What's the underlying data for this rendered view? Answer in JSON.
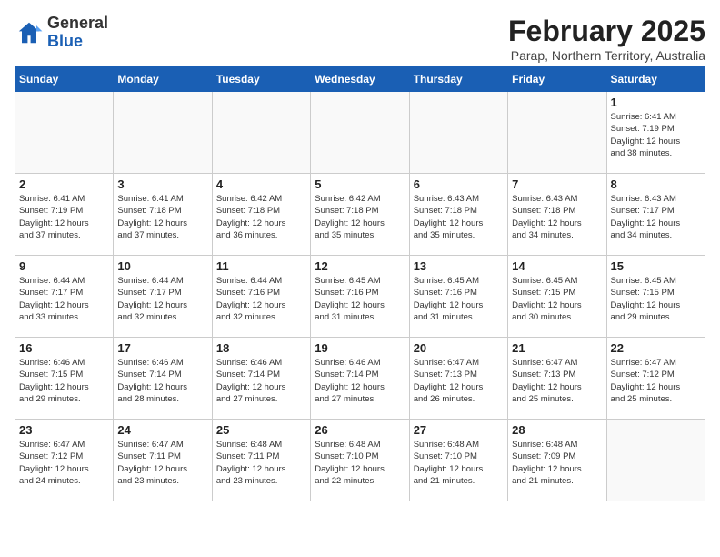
{
  "header": {
    "logo_general": "General",
    "logo_blue": "Blue",
    "title": "February 2025",
    "subtitle": "Parap, Northern Territory, Australia"
  },
  "weekdays": [
    "Sunday",
    "Monday",
    "Tuesday",
    "Wednesday",
    "Thursday",
    "Friday",
    "Saturday"
  ],
  "weeks": [
    [
      {
        "day": "",
        "info": ""
      },
      {
        "day": "",
        "info": ""
      },
      {
        "day": "",
        "info": ""
      },
      {
        "day": "",
        "info": ""
      },
      {
        "day": "",
        "info": ""
      },
      {
        "day": "",
        "info": ""
      },
      {
        "day": "1",
        "info": "Sunrise: 6:41 AM\nSunset: 7:19 PM\nDaylight: 12 hours\nand 38 minutes."
      }
    ],
    [
      {
        "day": "2",
        "info": "Sunrise: 6:41 AM\nSunset: 7:19 PM\nDaylight: 12 hours\nand 37 minutes."
      },
      {
        "day": "3",
        "info": "Sunrise: 6:41 AM\nSunset: 7:18 PM\nDaylight: 12 hours\nand 37 minutes."
      },
      {
        "day": "4",
        "info": "Sunrise: 6:42 AM\nSunset: 7:18 PM\nDaylight: 12 hours\nand 36 minutes."
      },
      {
        "day": "5",
        "info": "Sunrise: 6:42 AM\nSunset: 7:18 PM\nDaylight: 12 hours\nand 35 minutes."
      },
      {
        "day": "6",
        "info": "Sunrise: 6:43 AM\nSunset: 7:18 PM\nDaylight: 12 hours\nand 35 minutes."
      },
      {
        "day": "7",
        "info": "Sunrise: 6:43 AM\nSunset: 7:18 PM\nDaylight: 12 hours\nand 34 minutes."
      },
      {
        "day": "8",
        "info": "Sunrise: 6:43 AM\nSunset: 7:17 PM\nDaylight: 12 hours\nand 34 minutes."
      }
    ],
    [
      {
        "day": "9",
        "info": "Sunrise: 6:44 AM\nSunset: 7:17 PM\nDaylight: 12 hours\nand 33 minutes."
      },
      {
        "day": "10",
        "info": "Sunrise: 6:44 AM\nSunset: 7:17 PM\nDaylight: 12 hours\nand 32 minutes."
      },
      {
        "day": "11",
        "info": "Sunrise: 6:44 AM\nSunset: 7:16 PM\nDaylight: 12 hours\nand 32 minutes."
      },
      {
        "day": "12",
        "info": "Sunrise: 6:45 AM\nSunset: 7:16 PM\nDaylight: 12 hours\nand 31 minutes."
      },
      {
        "day": "13",
        "info": "Sunrise: 6:45 AM\nSunset: 7:16 PM\nDaylight: 12 hours\nand 31 minutes."
      },
      {
        "day": "14",
        "info": "Sunrise: 6:45 AM\nSunset: 7:15 PM\nDaylight: 12 hours\nand 30 minutes."
      },
      {
        "day": "15",
        "info": "Sunrise: 6:45 AM\nSunset: 7:15 PM\nDaylight: 12 hours\nand 29 minutes."
      }
    ],
    [
      {
        "day": "16",
        "info": "Sunrise: 6:46 AM\nSunset: 7:15 PM\nDaylight: 12 hours\nand 29 minutes."
      },
      {
        "day": "17",
        "info": "Sunrise: 6:46 AM\nSunset: 7:14 PM\nDaylight: 12 hours\nand 28 minutes."
      },
      {
        "day": "18",
        "info": "Sunrise: 6:46 AM\nSunset: 7:14 PM\nDaylight: 12 hours\nand 27 minutes."
      },
      {
        "day": "19",
        "info": "Sunrise: 6:46 AM\nSunset: 7:14 PM\nDaylight: 12 hours\nand 27 minutes."
      },
      {
        "day": "20",
        "info": "Sunrise: 6:47 AM\nSunset: 7:13 PM\nDaylight: 12 hours\nand 26 minutes."
      },
      {
        "day": "21",
        "info": "Sunrise: 6:47 AM\nSunset: 7:13 PM\nDaylight: 12 hours\nand 25 minutes."
      },
      {
        "day": "22",
        "info": "Sunrise: 6:47 AM\nSunset: 7:12 PM\nDaylight: 12 hours\nand 25 minutes."
      }
    ],
    [
      {
        "day": "23",
        "info": "Sunrise: 6:47 AM\nSunset: 7:12 PM\nDaylight: 12 hours\nand 24 minutes."
      },
      {
        "day": "24",
        "info": "Sunrise: 6:47 AM\nSunset: 7:11 PM\nDaylight: 12 hours\nand 23 minutes."
      },
      {
        "day": "25",
        "info": "Sunrise: 6:48 AM\nSunset: 7:11 PM\nDaylight: 12 hours\nand 23 minutes."
      },
      {
        "day": "26",
        "info": "Sunrise: 6:48 AM\nSunset: 7:10 PM\nDaylight: 12 hours\nand 22 minutes."
      },
      {
        "day": "27",
        "info": "Sunrise: 6:48 AM\nSunset: 7:10 PM\nDaylight: 12 hours\nand 21 minutes."
      },
      {
        "day": "28",
        "info": "Sunrise: 6:48 AM\nSunset: 7:09 PM\nDaylight: 12 hours\nand 21 minutes."
      },
      {
        "day": "",
        "info": ""
      }
    ]
  ]
}
